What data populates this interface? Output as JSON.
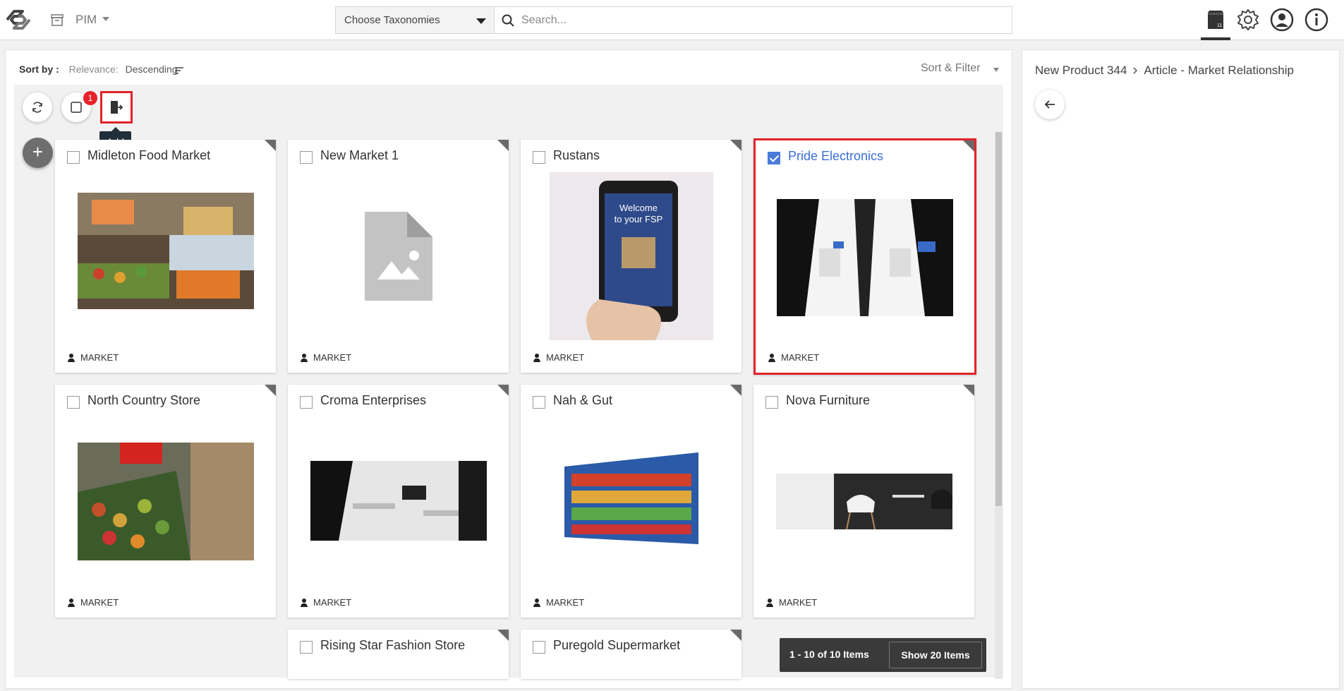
{
  "header": {
    "app_name": "PIM",
    "taxonomy_select": "Choose Taxonomies",
    "search_placeholder": "Search...",
    "icons": [
      "logo-icon",
      "archive-icon",
      "catalog-icon",
      "settings-gear-icon",
      "user-avatar-icon",
      "info-icon"
    ]
  },
  "toolbar": {
    "sort_by_label": "Sort by :",
    "sort_field": "Relevance:",
    "sort_order": "Descending",
    "sort_filter_label": "Sort & Filter",
    "badge_count": "1",
    "tooltip": "Add"
  },
  "cards": [
    {
      "title": "Midleton Food Market",
      "type": "MARKET",
      "checked": false
    },
    {
      "title": "New Market 1",
      "type": "MARKET",
      "checked": false
    },
    {
      "title": "Rustans",
      "type": "MARKET",
      "checked": false
    },
    {
      "title": "Pride Electronics",
      "type": "MARKET",
      "checked": true
    },
    {
      "title": "North Country Store",
      "type": "MARKET",
      "checked": false
    },
    {
      "title": "Croma Enterprises",
      "type": "MARKET",
      "checked": false
    },
    {
      "title": "Nah & Gut",
      "type": "MARKET",
      "checked": false
    },
    {
      "title": "Nova Furniture",
      "type": "MARKET",
      "checked": false
    },
    {
      "title": "Rising Star Fashion Store",
      "type": "MARKET",
      "checked": false
    },
    {
      "title": "Puregold Supermarket",
      "type": "MARKET",
      "checked": false
    }
  ],
  "pager": {
    "count_text": "1 - 10 of 10 Items",
    "show_more": "Show 20 Items"
  },
  "right_panel": {
    "breadcrumb_parent": "New Product 344",
    "breadcrumb_current": "Article - Market Relationship"
  },
  "colors": {
    "accent_blue": "#3a6fd8",
    "highlight_red": "#e0242c",
    "badge_red": "#e8202a"
  }
}
